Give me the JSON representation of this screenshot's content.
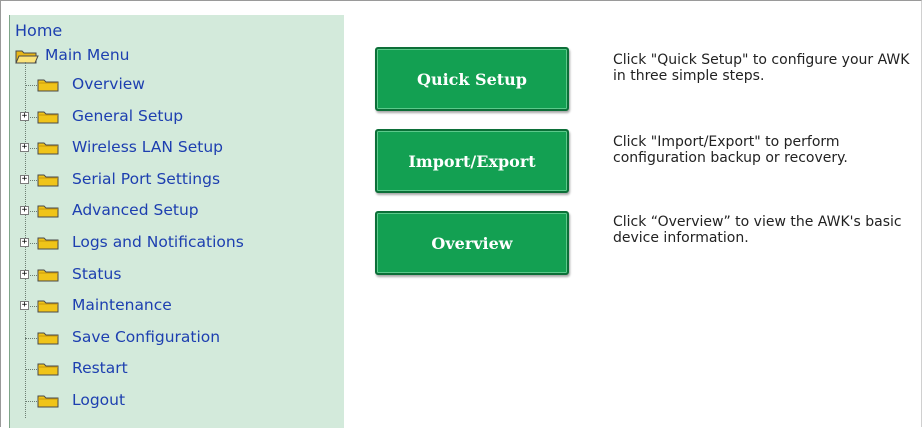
{
  "sidebar": {
    "home": "Home",
    "main_menu": "Main Menu",
    "items": [
      {
        "label": "Overview",
        "expandable": false
      },
      {
        "label": "General Setup",
        "expandable": true
      },
      {
        "label": "Wireless LAN Setup",
        "expandable": true
      },
      {
        "label": "Serial Port Settings",
        "expandable": true
      },
      {
        "label": "Advanced Setup",
        "expandable": true
      },
      {
        "label": "Logs and Notifications",
        "expandable": true
      },
      {
        "label": "Status",
        "expandable": true
      },
      {
        "label": "Maintenance",
        "expandable": true
      },
      {
        "label": "Save Configuration",
        "expandable": false
      },
      {
        "label": "Restart",
        "expandable": false
      },
      {
        "label": "Logout",
        "expandable": false
      }
    ]
  },
  "actions": [
    {
      "button": "Quick Setup",
      "description": "Click \"Quick Setup\" to configure your AWK in three simple steps."
    },
    {
      "button": "Import/Export",
      "description": "Click \"Import/Export\" to perform configuration backup or recovery."
    },
    {
      "button": "Overview",
      "description": "Click “Overview” to view the AWK's basic device information."
    }
  ],
  "colors": {
    "link": "#1d3fb0",
    "sidebar_bg": "#d3eadb",
    "button_green": "#13a052",
    "folder": "#f0c419"
  },
  "icons": {
    "folder": "folder-icon",
    "open_folder": "folder-open-icon",
    "expand": "expand-plus-icon"
  }
}
